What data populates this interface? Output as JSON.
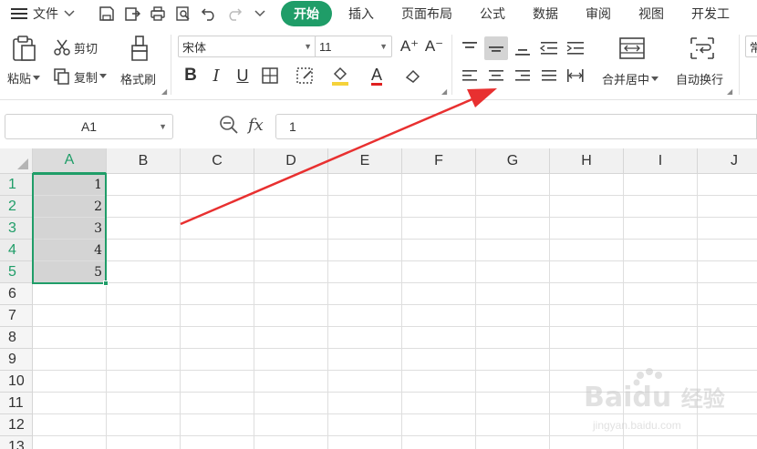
{
  "menu": {
    "file_label": "文件",
    "tabs": [
      "开始",
      "插入",
      "页面布局",
      "公式",
      "数据",
      "审阅",
      "视图",
      "开发工"
    ]
  },
  "ribbon": {
    "paste_label": "粘贴",
    "cut_label": "剪切",
    "copy_label": "复制",
    "format_painter_label": "格式刷",
    "font_name": "宋体",
    "font_size": "11",
    "font_size_increase": "A⁺",
    "font_size_decrease": "A⁻",
    "bold": "B",
    "italic": "I",
    "underline": "U",
    "font_color_glyph": "A",
    "merge_center_label": "合并居中",
    "wrap_text_label": "自动换行",
    "number_format_partial": "常",
    "colors": {
      "accent": "#1f9d68",
      "fill_highlight": "#f5d23a",
      "font_color": "#e02020"
    }
  },
  "formula_bar": {
    "name_box": "A1",
    "fx_label": "fx",
    "content": "1"
  },
  "sheet": {
    "columns": [
      "A",
      "B",
      "C",
      "D",
      "E",
      "F",
      "G",
      "H",
      "I",
      "J"
    ],
    "rows": [
      "1",
      "2",
      "3",
      "4",
      "5",
      "6",
      "7",
      "8",
      "9",
      "10",
      "11",
      "12",
      "13"
    ],
    "a_values": [
      "1",
      "2",
      "3",
      "4",
      "5"
    ],
    "selected_column": "A",
    "selected_rows": [
      "1",
      "2",
      "3",
      "4",
      "5"
    ]
  },
  "annotation": {
    "arrow_color": "#e83030"
  },
  "watermark": {
    "brand": "Bai",
    "brand2": "du",
    "cn": "经验",
    "url": "jingyan.baidu.com"
  }
}
